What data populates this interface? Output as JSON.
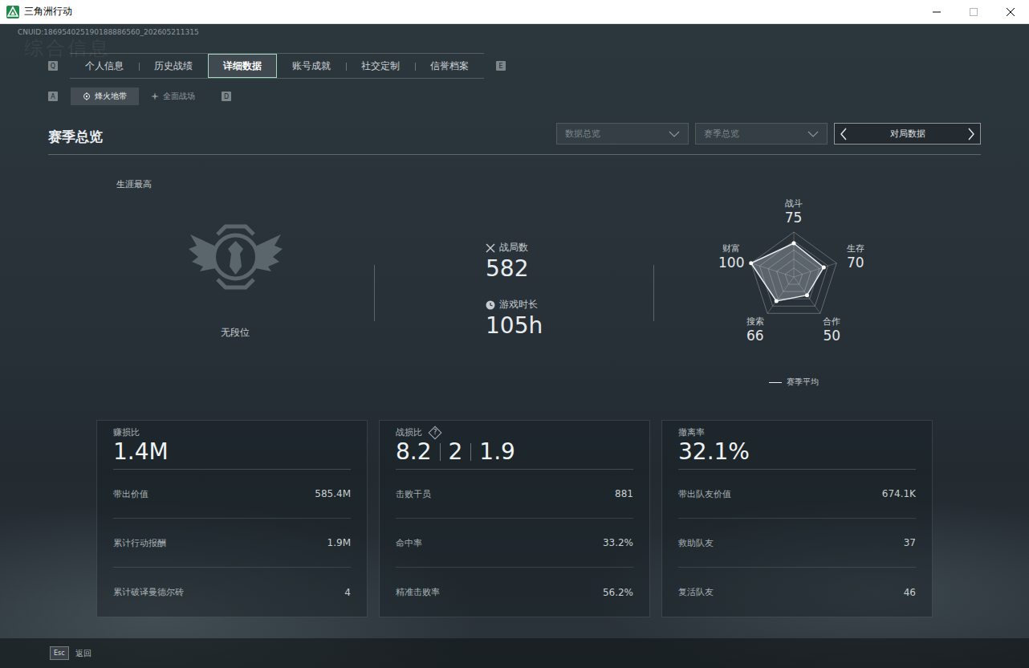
{
  "window": {
    "title": "三角洲行动"
  },
  "uid": "CNUID:186954025190188886560_202605211315",
  "watermark": "综合信息",
  "tabs": {
    "prev_key": "Q",
    "next_key": "E",
    "items": [
      {
        "label": "个人信息",
        "selected": false
      },
      {
        "label": "历史战绩",
        "selected": false
      },
      {
        "label": "详细数据",
        "selected": true
      },
      {
        "label": "账号成就",
        "selected": false
      },
      {
        "label": "社交定制",
        "selected": false
      },
      {
        "label": "信誉档案",
        "selected": false
      }
    ]
  },
  "sub_tabs": {
    "prev_key": "A",
    "next_key": "D",
    "items": [
      {
        "label": "烽火地带",
        "selected": true,
        "kind": "fire"
      },
      {
        "label": "全面战场",
        "selected": false,
        "kind": "battlefield"
      }
    ]
  },
  "section": {
    "title": "赛季总览",
    "dropdowns": [
      {
        "label": "数据总览"
      },
      {
        "label": "赛季总览"
      }
    ],
    "pager": {
      "label": "对局数据"
    }
  },
  "rank": {
    "title": "生涯最高",
    "name": "无段位"
  },
  "stats": [
    {
      "label": "战局数",
      "value": "582",
      "kind": "battles"
    },
    {
      "label": "游戏时长",
      "value": "105h",
      "kind": "time"
    }
  ],
  "radar": {
    "axes": [
      {
        "label": "战斗",
        "value": "75",
        "level": 0.75
      },
      {
        "label": "生存",
        "value": "70",
        "level": 0.7
      },
      {
        "label": "合作",
        "value": "50",
        "level": 0.5
      },
      {
        "label": "搜索",
        "value": "66",
        "level": 0.66
      },
      {
        "label": "财富",
        "value": "100",
        "level": 1.0
      }
    ],
    "legend": "赛季平均"
  },
  "cards": [
    {
      "title": "赚损比",
      "help": null,
      "values": [
        "1.4M"
      ],
      "rows": [
        {
          "label": "带出价值",
          "value": "585.4M"
        },
        {
          "label": "累计行动报酬",
          "value": "1.9M"
        },
        {
          "label": "累计破译曼德尔砖",
          "value": "4"
        }
      ]
    },
    {
      "title": "战损比",
      "help": "?",
      "values": [
        "8.2",
        "2",
        "1.9"
      ],
      "rows": [
        {
          "label": "击败干员",
          "value": "881"
        },
        {
          "label": "命中率",
          "value": "33.2%"
        },
        {
          "label": "精准击败率",
          "value": "56.2%"
        }
      ]
    },
    {
      "title": "撤离率",
      "help": null,
      "values": [
        "32.1%"
      ],
      "rows": [
        {
          "label": "带出队友价值",
          "value": "674.1K"
        },
        {
          "label": "救助队友",
          "value": "37"
        },
        {
          "label": "复活队友",
          "value": "46"
        }
      ]
    }
  ],
  "footer": {
    "key": "Esc",
    "label": "返回"
  }
}
